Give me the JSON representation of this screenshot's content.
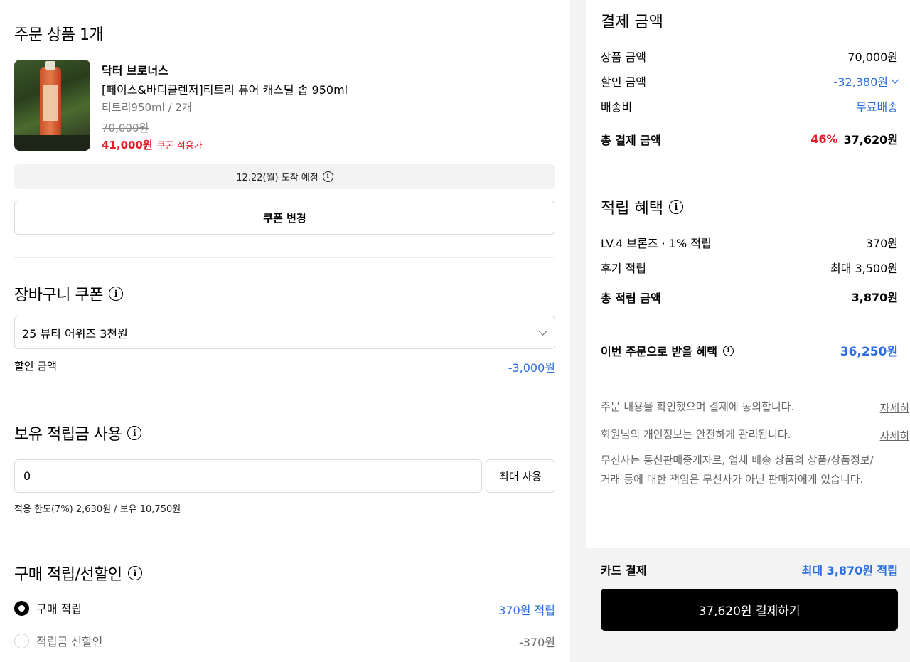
{
  "order": {
    "heading": "주문 상품 1개",
    "product": {
      "brand": "닥터 브로너스",
      "name": "[페이스&바디클렌저]티트리 퓨어 캐스틸 솝 950ml",
      "option": "티트리950ml / 2개",
      "original_price": "70,000원",
      "sale_price": "41,000원",
      "sale_tag": "쿠폰 적용가"
    },
    "delivery": "12.22(월) 도착 예정",
    "coupon_change_label": "쿠폰 변경"
  },
  "cart_coupon": {
    "heading": "장바구니 쿠폰",
    "selected": "25 뷰티 어워즈 3천원",
    "discount_label": "할인 금액",
    "discount_value": "-3,000원"
  },
  "points": {
    "heading": "보유 적립금 사용",
    "input_value": "0",
    "max_label": "최대 사용",
    "limit_text": "적용 한도(7%) 2,630원 / 보유 10,750원"
  },
  "purchase_reward": {
    "heading": "구매 적립/선할인",
    "options": [
      {
        "label": "구매 적립",
        "value": "370원 적립",
        "selected": true
      },
      {
        "label": "적립금 선할인",
        "value": "-370원",
        "selected": false
      }
    ]
  },
  "payment": {
    "heading": "결제 금액",
    "rows": [
      {
        "label": "상품 금액",
        "value": "70,000원"
      },
      {
        "label": "할인 금액",
        "value": "-32,380원"
      },
      {
        "label": "배송비",
        "value": "무료배송"
      }
    ],
    "total_label": "총 결제 금액",
    "total_rate": "46%",
    "total_value": "37,620원"
  },
  "rewards": {
    "heading": "적립 혜택",
    "rows": [
      {
        "label": "LV.4 브론즈 · 1% 적립",
        "value": "370원"
      },
      {
        "label": "후기 적립",
        "value": "최대 3,500원"
      }
    ],
    "total_label": "총 적립 금액",
    "total_value": "3,870원",
    "benefit_label": "이번 주문으로 받을 혜택",
    "benefit_value": "36,250원"
  },
  "legal": {
    "agree_text": "주문 내용을 확인했으며 결제에 동의합니다.",
    "privacy_text": "회원님의 개인정보는 안전하게 관리됩니다.",
    "detail_link": "자세히",
    "notice_line1": "무신사는 통신판매중개자로, 업체 배송 상품의 상품/상품정보/",
    "notice_line2": "거래 등에 대한 책임은 무신사가 아닌 판매자에게 있습니다."
  },
  "checkout": {
    "card_label": "카드 결제",
    "card_reward": "최대 3,870원 적립",
    "pay_button": "37,620원 결제하기"
  },
  "colors": {
    "accent_blue": "#2b6de0",
    "sale_red": "#e5202e",
    "button_black": "#000000"
  }
}
